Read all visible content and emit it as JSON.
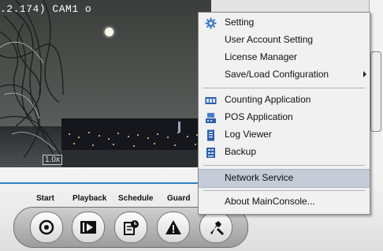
{
  "camera": {
    "title": ".2.174)  CAM1 o",
    "zoom": "1.0x"
  },
  "toolbar": {
    "labels": {
      "start": "Start",
      "playback": "Playback",
      "schedule": "Schedule",
      "guard": "Guard"
    },
    "buttons": [
      "start-icon",
      "playback-icon",
      "schedule-icon",
      "guard-icon",
      "tools-icon"
    ]
  },
  "menu": {
    "setting": "Setting",
    "user_account": "User Account Setting",
    "license": "License Manager",
    "save_load": "Save/Load Configuration",
    "counting": "Counting Application",
    "pos": "POS Application",
    "log": "Log Viewer",
    "backup": "Backup",
    "network": "Network Service",
    "about": "About MainConsole..."
  },
  "colors": {
    "highlight": "#c6cbd8",
    "accent_line": "#2b82c7"
  }
}
